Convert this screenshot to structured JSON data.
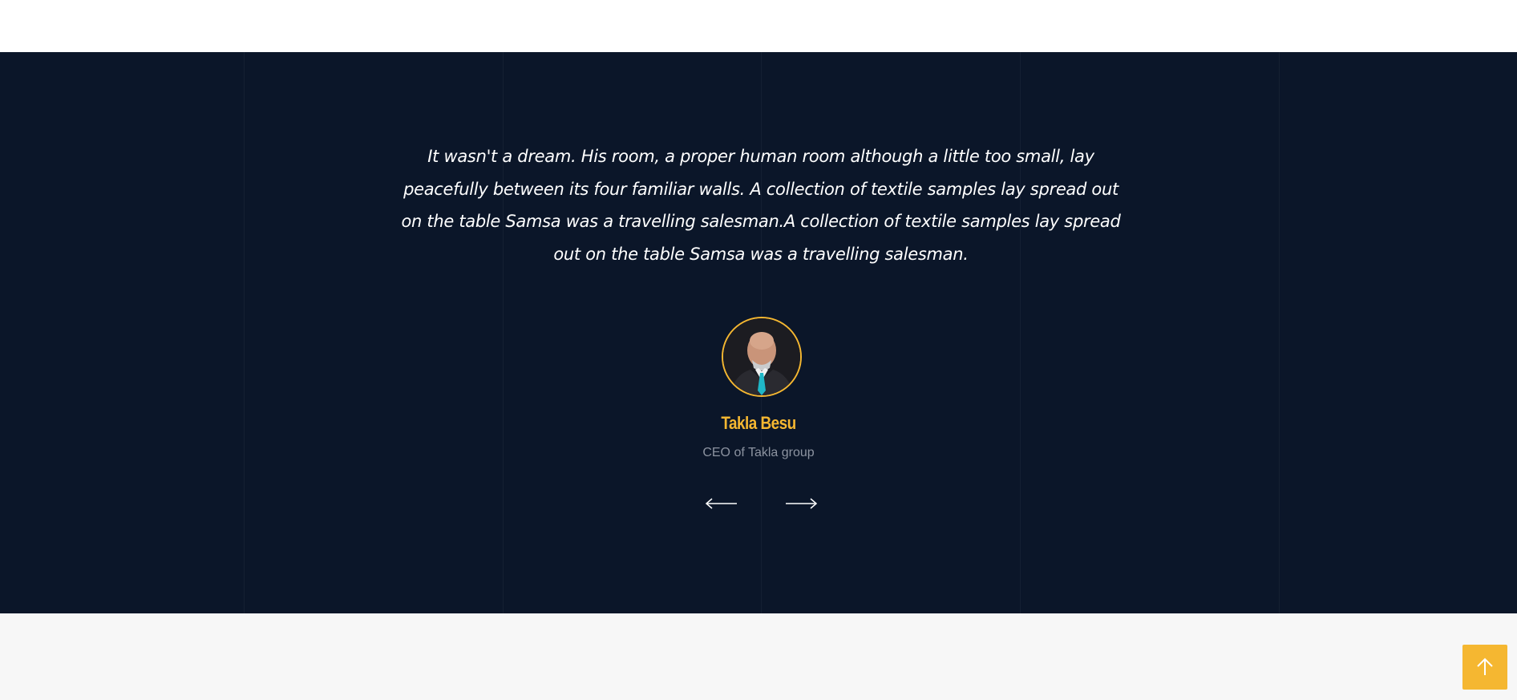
{
  "testimonial": {
    "quote_lines": [
      "It wasn't a dream. His room, a proper human room although a little too small, lay",
      "peacefully between its four familiar walls. A collection of textile samples lay spread out",
      "on the table Samsa was a travelling salesman.A collection of textile samples lay spread",
      "out on the table Samsa was a travelling salesman."
    ],
    "author_name": "Takla Besu",
    "author_role": "CEO of Takla group"
  },
  "navigation": {
    "prev_icon": "arrow-left-icon",
    "next_icon": "arrow-right-icon"
  },
  "back_to_top": {
    "icon": "arrow-up-icon"
  },
  "colors": {
    "section_background": "#0b1629",
    "accent": "#f5b731",
    "quote_text": "#ffffff",
    "role_text": "#8c93a0",
    "bottom_background": "#f7f7f7"
  }
}
